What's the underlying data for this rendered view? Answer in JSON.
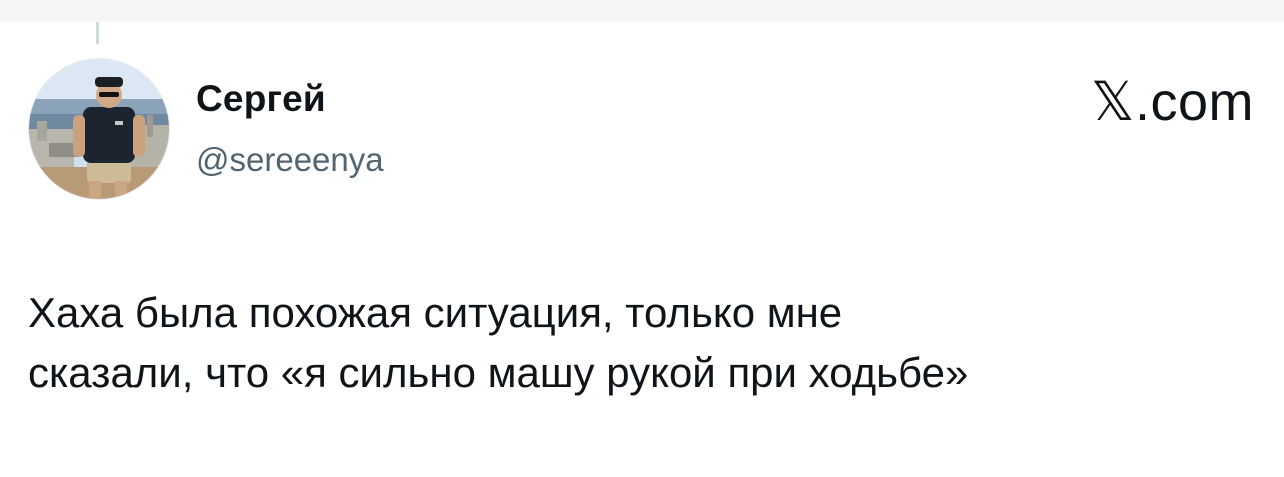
{
  "brand": {
    "label": "𝕏.com"
  },
  "author": {
    "display_name": "Сергей",
    "handle": "@sereeenya"
  },
  "tweet": {
    "text": "Хаха была похожая ситуация, только мне\nсказали, что «я сильно машу рукой при ходьбе»"
  },
  "colors": {
    "text_primary": "#0f1419",
    "text_secondary": "#536471",
    "thread_line": "#cfd9de",
    "top_strip": "#f5f6f7"
  }
}
